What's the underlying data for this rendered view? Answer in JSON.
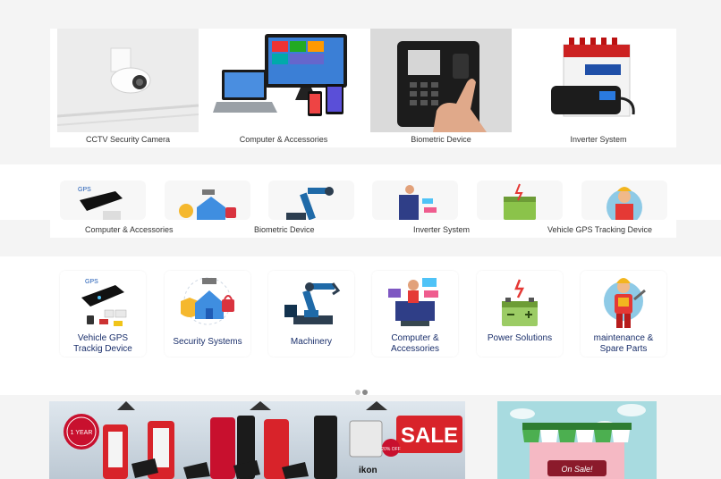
{
  "top_products": [
    {
      "label": "CCTV Security Camera",
      "icon": "cctv-camera-image"
    },
    {
      "label": "Computer & Accessories",
      "icon": "computer-devices-image"
    },
    {
      "label": "Biometric Device",
      "icon": "biometric-scanner-image"
    },
    {
      "label": "Inverter System",
      "icon": "inverter-battery-image"
    }
  ],
  "mid_labels": [
    "Computer & Accessories",
    "Biometric Device",
    "Inverter System",
    "Vehicle GPS Tracking Device"
  ],
  "categories": [
    {
      "label_line1": "Vehicle GPS",
      "label_line2": "Trackig Device",
      "icon": "gps-tracker-icon",
      "gps_text": "GPS"
    },
    {
      "label_line1": "Security Systems",
      "label_line2": "",
      "icon": "security-house-icon"
    },
    {
      "label_line1": "Machinery",
      "label_line2": "",
      "icon": "robot-arm-icon"
    },
    {
      "label_line1": "Computer &",
      "label_line2": "Accessories",
      "icon": "computer-accessories-icon"
    },
    {
      "label_line1": "Power Solutions",
      "label_line2": "",
      "icon": "battery-icon"
    },
    {
      "label_line1": "maintenance &",
      "label_line2": "Spare Parts",
      "icon": "worker-icon"
    }
  ],
  "carousel": {
    "pages": 2,
    "active": 2
  },
  "sale_banner": {
    "sale_text": "SALE",
    "brand": "ikon",
    "badge": "1 YEAR",
    "off": "20% OFF"
  },
  "shop_banner": {
    "sign_text": "On Sale!"
  },
  "colors": {
    "label_blue": "#1a2f6b",
    "sale_red": "#d8232a",
    "tag_black": "#1b1b1b"
  }
}
